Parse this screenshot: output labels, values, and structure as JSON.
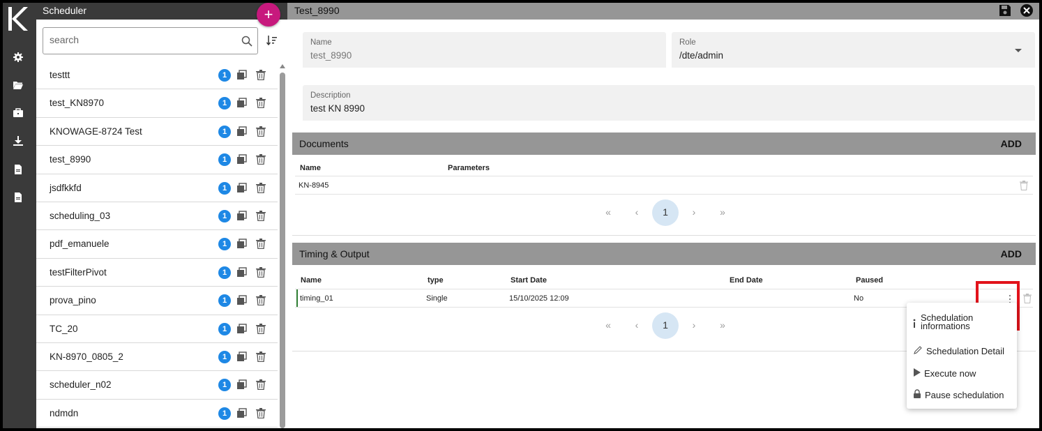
{
  "rail": {
    "logo_letter": "K",
    "icons": [
      "gear-icon",
      "folder-open-icon",
      "briefcase-icon",
      "download-icon",
      "document-icon",
      "document-icon-2"
    ]
  },
  "list_panel": {
    "title": "Scheduler",
    "add_label": "+",
    "search": {
      "placeholder": "search",
      "value": ""
    },
    "items": [
      {
        "label": "testtt",
        "badge": "1"
      },
      {
        "label": "test_KN8970",
        "badge": "1"
      },
      {
        "label": "KNOWAGE-8724 Test",
        "badge": "1"
      },
      {
        "label": "test_8990",
        "badge": "1"
      },
      {
        "label": "jsdfkkfd",
        "badge": "1"
      },
      {
        "label": "scheduling_03",
        "badge": "1"
      },
      {
        "label": "pdf_emanuele",
        "badge": "1"
      },
      {
        "label": "testFilterPivot",
        "badge": "1"
      },
      {
        "label": "prova_pino",
        "badge": "1"
      },
      {
        "label": "TC_20",
        "badge": "1"
      },
      {
        "label": "KN-8970_0805_2",
        "badge": "1"
      },
      {
        "label": "scheduler_n02",
        "badge": "1"
      },
      {
        "label": "ndmdn",
        "badge": "1"
      }
    ]
  },
  "detail": {
    "title": "Test_8990",
    "name": {
      "label": "Name",
      "value": "test_8990"
    },
    "role": {
      "label": "Role",
      "value": "/dte/admin"
    },
    "description": {
      "label": "Description",
      "value": "test KN 8990"
    },
    "documents": {
      "title": "Documents",
      "add_label": "ADD",
      "columns": [
        "Name",
        "Parameters"
      ],
      "rows": [
        {
          "name": "KN-8945",
          "parameters": ""
        }
      ],
      "pager": {
        "first": "«",
        "prev": "‹",
        "current": "1",
        "next": "›",
        "last": "»"
      }
    },
    "timing": {
      "title": "Timing & Output",
      "add_label": "ADD",
      "columns": [
        "Name",
        "type",
        "Start Date",
        "End Date",
        "Paused"
      ],
      "rows": [
        {
          "name": "timing_01",
          "type": "Single",
          "start": "15/10/2025 12:09",
          "end": "",
          "paused": "No"
        }
      ],
      "pager": {
        "first": "«",
        "prev": "‹",
        "current": "1",
        "next": "›",
        "last": "»"
      }
    },
    "context_menu": {
      "items": [
        {
          "label": "Schedulation informations",
          "icon": "info-icon"
        },
        {
          "label": "Schedulation Detail",
          "icon": "pencil-icon"
        },
        {
          "label": "Execute now",
          "icon": "play-icon"
        },
        {
          "label": "Pause schedulation",
          "icon": "lock-icon"
        }
      ]
    }
  },
  "colors": {
    "accent": "#c7197d",
    "badge": "#1e88e5",
    "highlight": "#e2131b",
    "header_bg": "#969696",
    "rail_bg": "#3a3a3a"
  }
}
